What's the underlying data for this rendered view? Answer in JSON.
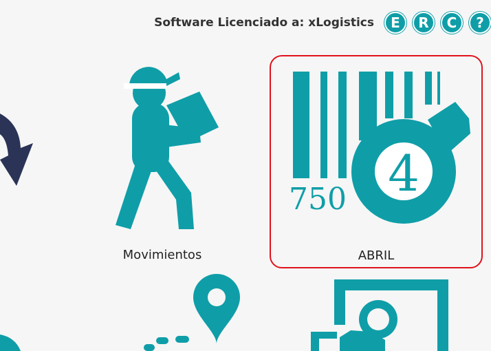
{
  "header": {
    "license_text": "Software Licenciado a: xLogistics",
    "buttons": [
      {
        "label": "E"
      },
      {
        "label": "R"
      },
      {
        "label": "C"
      },
      {
        "label": "?"
      }
    ]
  },
  "tiles": [
    {
      "label": "Movimientos",
      "icon": "worker-carrying-box-icon"
    },
    {
      "label": "ABRIL",
      "icon": "barcode-tag-icon",
      "selected": true,
      "barcode_number": "750",
      "tag_number": "4"
    }
  ],
  "colors": {
    "accent": "#0f9ea8",
    "dark_navy": "#2b3457",
    "selection_border": "#e0121b",
    "background": "#f6f6f6"
  }
}
